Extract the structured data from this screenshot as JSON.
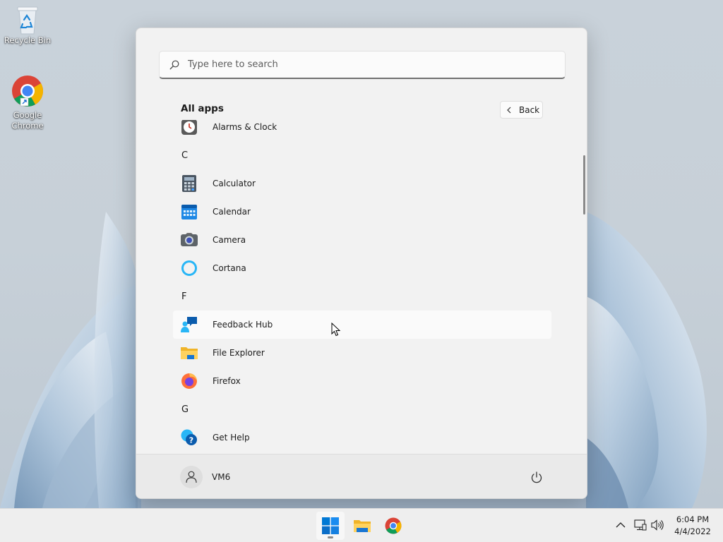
{
  "desktop": {
    "recycle_bin_label": "Recycle Bin",
    "chrome_label_line1": "Google",
    "chrome_label_line2": "Chrome"
  },
  "start_menu": {
    "search_placeholder": "Type here to search",
    "all_apps_title": "All apps",
    "back_label": "Back",
    "apps": {
      "alarms": "Alarms & Clock",
      "letter_c": "C",
      "calculator": "Calculator",
      "calendar": "Calendar",
      "camera": "Camera",
      "cortana": "Cortana",
      "letter_f": "F",
      "feedback_hub": "Feedback Hub",
      "file_explorer": "File Explorer",
      "firefox": "Firefox",
      "letter_g": "G",
      "get_help": "Get Help"
    },
    "user_name": "VM6"
  },
  "taskbar": {
    "time": "6:04 PM",
    "date": "4/4/2022"
  },
  "colors": {
    "accent": "#0067c0",
    "windows_blue": "#0078d4",
    "menu_bg": "#f2f2f2",
    "taskbar_bg": "#eeeeee"
  }
}
